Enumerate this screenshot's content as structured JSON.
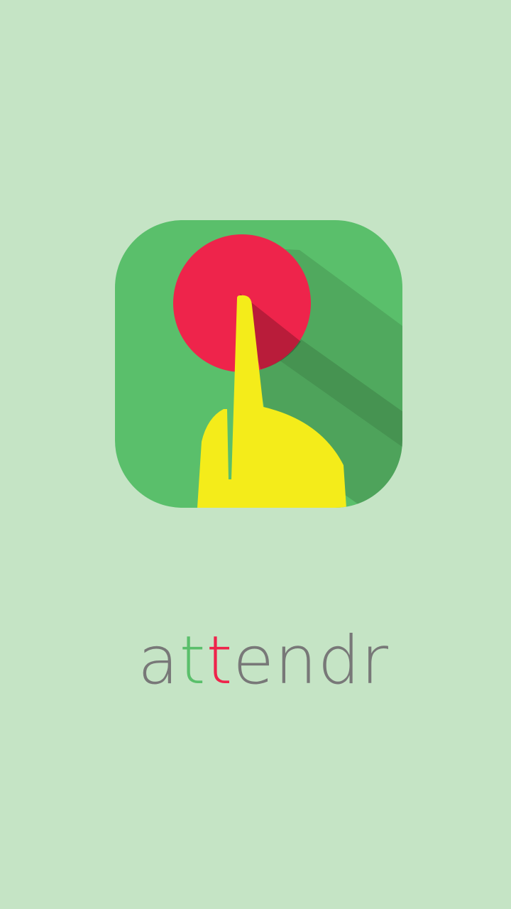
{
  "splash": {
    "background_color": "#c5e4c5",
    "logo": {
      "icon": "finger-pressing-button-icon",
      "tile_color": "#5abf6b",
      "button_color": "#ee244b",
      "hand_color": "#f4ec1a",
      "shadow_color": "#2e5a33"
    },
    "wordmark": {
      "segments": [
        {
          "text": "a",
          "color": "#787878"
        },
        {
          "text": "t",
          "color": "#5abf6b"
        },
        {
          "text": "t",
          "color": "#ee244b"
        },
        {
          "text": "endr",
          "color": "#787878"
        }
      ]
    }
  }
}
